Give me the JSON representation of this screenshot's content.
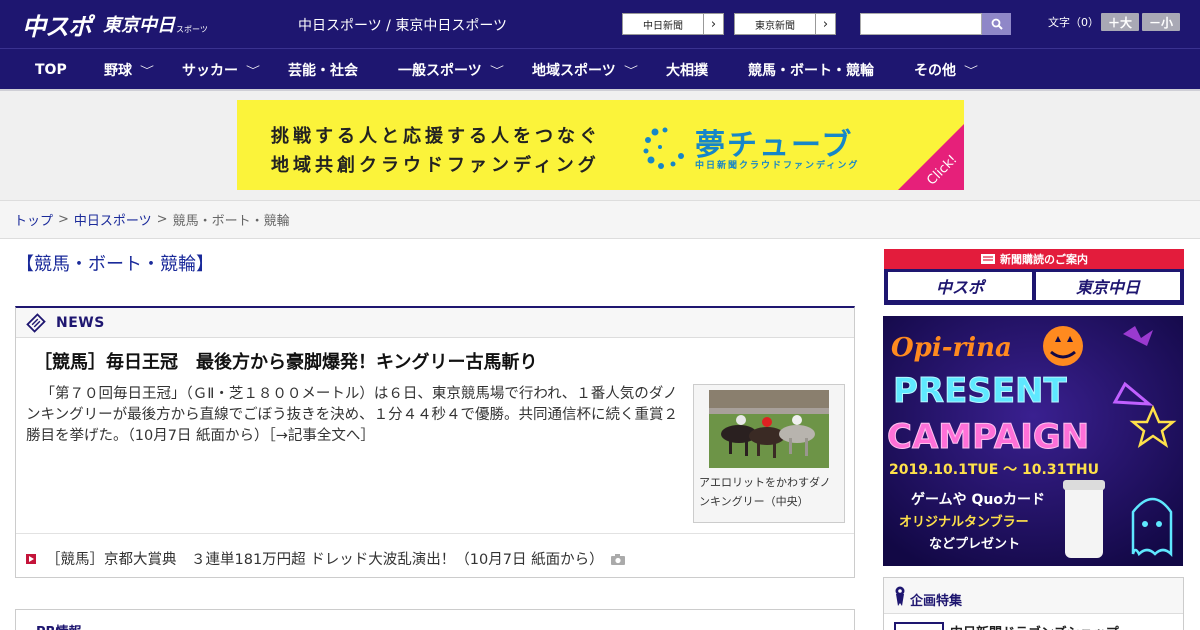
{
  "header": {
    "logo_main": "中スポ",
    "logo_sub": "東京中日",
    "logo_tiny": "スポーツ",
    "site_name": "中日スポーツ / 東京中日スポーツ",
    "paper_links": [
      {
        "label": "中日新聞",
        "arrow": "›"
      },
      {
        "label": "東京新聞",
        "arrow": "›"
      }
    ],
    "search": {
      "placeholder": "",
      "icon": "search-icon"
    },
    "font_size": {
      "label": "文字（0）",
      "larger": "＋大",
      "smaller": "－小"
    }
  },
  "nav": {
    "items": [
      {
        "label": "TOP",
        "has_dropdown": false
      },
      {
        "label": "野球",
        "has_dropdown": true
      },
      {
        "label": "サッカー",
        "has_dropdown": true
      },
      {
        "label": "芸能・社会",
        "has_dropdown": false
      },
      {
        "label": "一般スポーツ",
        "has_dropdown": true
      },
      {
        "label": "地域スポーツ",
        "has_dropdown": true
      },
      {
        "label": "大相撲",
        "has_dropdown": false
      },
      {
        "label": "競馬・ボート・競輪",
        "has_dropdown": false
      },
      {
        "label": "その他",
        "has_dropdown": true
      }
    ],
    "chevron": "﹀"
  },
  "banner": {
    "line1": "挑戦する人と応援する人をつなぐ",
    "line2": "地域共創クラウドファンディング",
    "brand": "夢チューブ",
    "brand_sub": "中日新聞クラウドファンディング",
    "corner": "Click!",
    "colors": {
      "background": "#fbf33a",
      "brand": "#1686c8",
      "corner": "#e6207a"
    }
  },
  "breadcrumb": {
    "items": [
      "トップ",
      "中日スポーツ",
      "競馬・ボート・競輪"
    ],
    "separator": ">"
  },
  "page_title": "【競馬・ボート・競輪】",
  "news": {
    "title": "NEWS",
    "headline": "［競馬］毎日王冠　最後方から豪脚爆発！キングリー古馬斬り",
    "body": "「第７０回毎日王冠」（ＧⅡ・芝１８００メートル）は６日、東京競馬場で行われ、１番人気のダノンキングリーが最後方から直線でごぼう抜きを決め、１分４４秒４で優勝。共同通信杯に続く重賞２勝目を挙げた。（10月7日 紙面から）［→記事全文へ］",
    "photo_caption": "アエロリットをかわすダノンキングリー（中央）",
    "sub_items": [
      {
        "text": "［競馬］京都大賞典　３連単181万円超 ドレッド大波乱演出！（10月7日 紙面から）",
        "icon": "camera-icon"
      }
    ]
  },
  "pr": {
    "title": "PR情報"
  },
  "sidebar": {
    "subscription_head": "新聞購読のご案内",
    "subscription_buttons": [
      "中スポ",
      "東京中日"
    ],
    "campaign": {
      "brand": "Opi-rina",
      "line1": "PRESENT",
      "line2": "CAMPAIGN",
      "dates": "2019.10.1TUE 〜 10.31THU",
      "prizes1": "ゲームや Quoカード",
      "prizes2": "オリジナルタンブラー",
      "prizes3": "などプレゼント"
    },
    "feature_title": "企画特集",
    "feature_item": "中日新聞ドラゴンズショップ"
  },
  "colors": {
    "header_bg": "#1e1670",
    "link": "#1a2a9a",
    "bullet": "#c4143a",
    "subscription_head": "#e31c3c"
  }
}
